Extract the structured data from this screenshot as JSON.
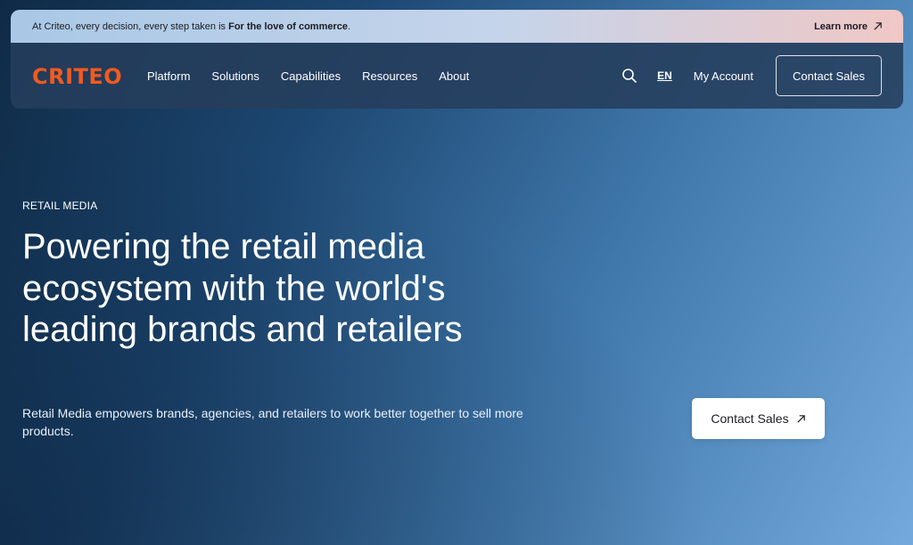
{
  "announcement": {
    "text_prefix": "At Criteo, every decision, every step taken is ",
    "text_bold": "For the love of commerce",
    "text_suffix": ".",
    "link_label": "Learn more"
  },
  "nav": {
    "logo": "CRITEO",
    "items": [
      {
        "label": "Platform"
      },
      {
        "label": "Solutions"
      },
      {
        "label": "Capabilities"
      },
      {
        "label": "Resources"
      },
      {
        "label": "About"
      }
    ],
    "language": "EN",
    "account_label": "My Account",
    "cta_label": "Contact Sales",
    "search_icon": "search-icon"
  },
  "hero": {
    "eyebrow": "RETAIL MEDIA",
    "headline": "Powering the retail media ecosystem with the world's leading brands and retailers",
    "subtext": "Retail Media empowers brands, agencies, and retailers to work better together to sell more products.",
    "cta_label": "Contact Sales"
  },
  "colors": {
    "brand": "#f25a1f",
    "background_dark": "#0f2a45",
    "background_light": "#73a9dc"
  }
}
